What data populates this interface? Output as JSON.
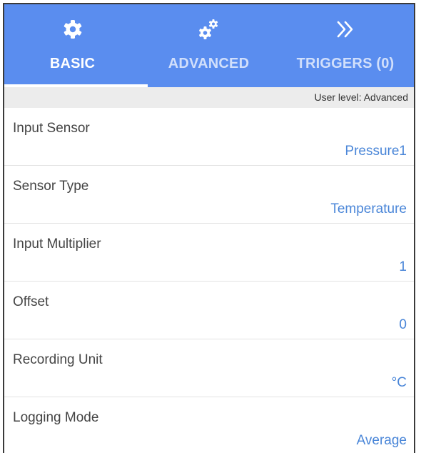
{
  "tabs": [
    {
      "label": "BASIC",
      "icon": "gear-icon",
      "active": true
    },
    {
      "label": "ADVANCED",
      "icon": "gears-icon",
      "active": false
    },
    {
      "label": "TRIGGERS (0)",
      "icon": "double-chevron-right-icon",
      "active": false
    }
  ],
  "user_level": "User level: Advanced",
  "settings": [
    {
      "name": "Input Sensor",
      "value": "Pressure1"
    },
    {
      "name": "Sensor Type",
      "value": "Temperature"
    },
    {
      "name": "Input Multiplier",
      "value": "1"
    },
    {
      "name": "Offset",
      "value": "0"
    },
    {
      "name": "Recording Unit",
      "value": "°C"
    },
    {
      "name": "Logging Mode",
      "value": "Average"
    }
  ],
  "colors": {
    "tab_bar": "#5a8def",
    "value_text": "#4a86d8",
    "level_bar": "#ececec"
  }
}
